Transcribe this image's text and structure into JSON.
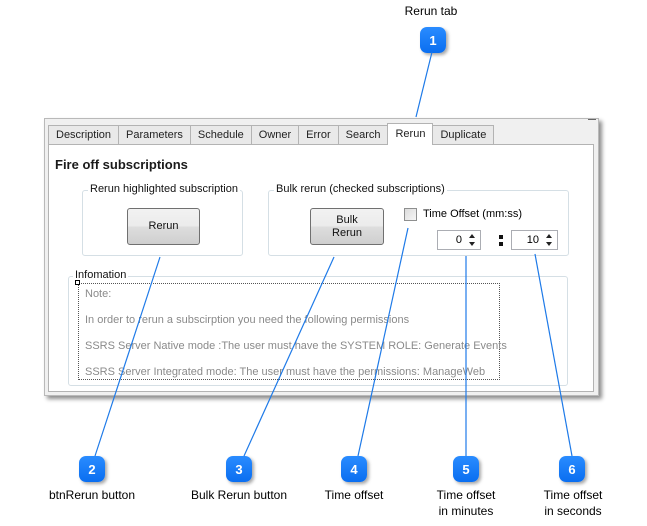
{
  "annotations": [
    {
      "number": "1",
      "label": "Rerun tab"
    },
    {
      "number": "2",
      "label": "btnRerun button"
    },
    {
      "number": "3",
      "label": "Bulk Rerun button"
    },
    {
      "number": "4",
      "label": "Time offset"
    },
    {
      "number": "5",
      "label_line1": "Time offset",
      "label_line2": "in minutes"
    },
    {
      "number": "6",
      "label_line1": "Time offset",
      "label_line2": "in seconds"
    }
  ],
  "window": {
    "tabs": [
      {
        "label": "Description",
        "active": false
      },
      {
        "label": "Parameters",
        "active": false
      },
      {
        "label": "Schedule",
        "active": false
      },
      {
        "label": "Owner",
        "active": false
      },
      {
        "label": "Error",
        "active": false
      },
      {
        "label": "Search",
        "active": false
      },
      {
        "label": "Rerun",
        "active": true
      },
      {
        "label": "Duplicate",
        "active": false
      }
    ],
    "page_title": "Fire off subscriptions",
    "rerun_group": {
      "legend": "Rerun highlighted subscription",
      "button_label": "Rerun"
    },
    "bulk_group": {
      "legend": "Bulk rerun (checked subscriptions)",
      "button_line1": "Bulk",
      "button_line2": "Rerun",
      "time_offset_label": "Time Offset (mm:ss)",
      "time_offset_checked": false,
      "minutes_value": "0",
      "seconds_value": "10"
    },
    "info_group": {
      "legend": "Infomation",
      "lines": [
        "Note:",
        "In order to rerun a subscirption you need the following permissions",
        "SSRS Server Native mode :The user must have the SYSTEM ROLE: Generate Events",
        "SSRS Server Integrated mode: The user must have the permissions: ManageWeb"
      ]
    }
  },
  "colors": {
    "badge": "#0a6ef0",
    "leader_line": "#1e7ae8"
  }
}
